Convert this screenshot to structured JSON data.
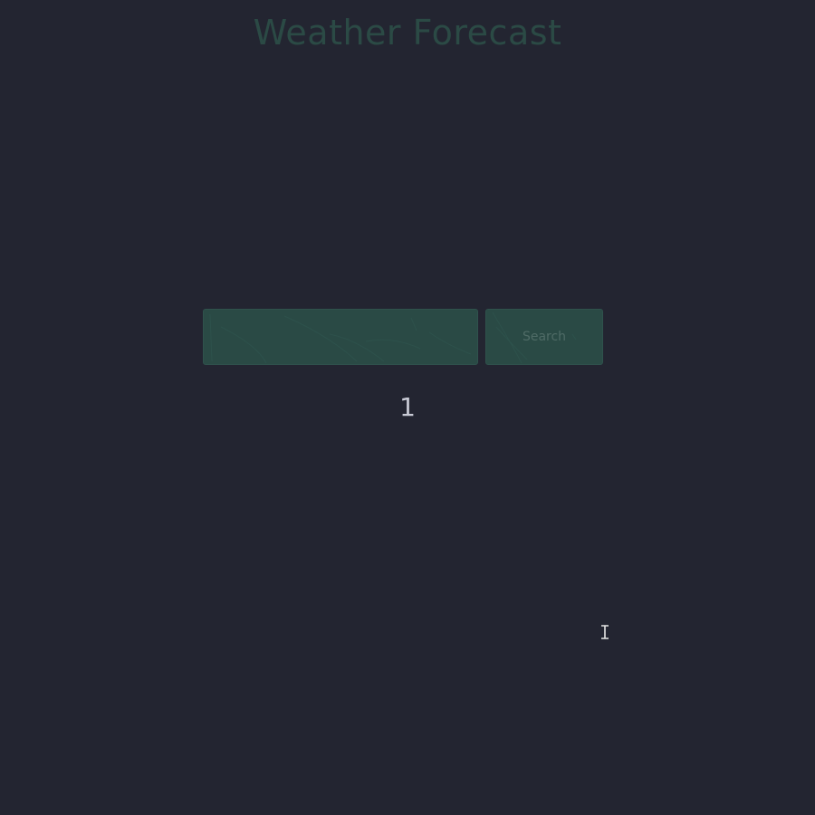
{
  "header": {
    "title": "Weather Forecast"
  },
  "search": {
    "value": "",
    "placeholder": "",
    "button_label": "Search"
  },
  "pagination": {
    "current_page": "1"
  },
  "colors": {
    "background": "#232531",
    "accent": "#2a4a45",
    "title_text": "#2b4a45",
    "page_number_text": "#c9cbd6"
  },
  "icons": {
    "cursor": "text-cursor-icon"
  }
}
